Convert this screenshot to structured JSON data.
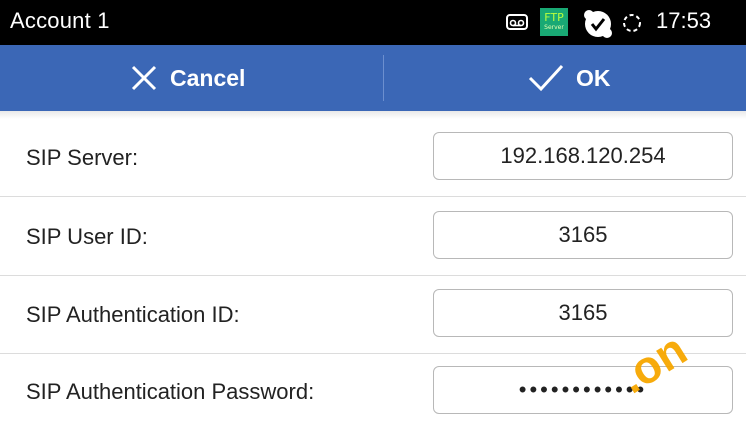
{
  "statusbar": {
    "title": "Account 1",
    "ftp_label": "FTP",
    "ftp_sub": "Server",
    "time": "17:53"
  },
  "actionbar": {
    "cancel_label": "Cancel",
    "ok_label": "OK"
  },
  "fields": [
    {
      "label": "SIP Server:",
      "value": "192.168.120.254"
    },
    {
      "label": "SIP User ID:",
      "value": "3165"
    },
    {
      "label": "SIP Authentication ID:",
      "value": "3165"
    },
    {
      "label": "SIP Authentication Password:",
      "value": "••••••••••••"
    }
  ],
  "watermark": ".on",
  "colors": {
    "actionbar": "#3b67b6",
    "statusbar": "#000000",
    "ftp": "#19a974"
  }
}
